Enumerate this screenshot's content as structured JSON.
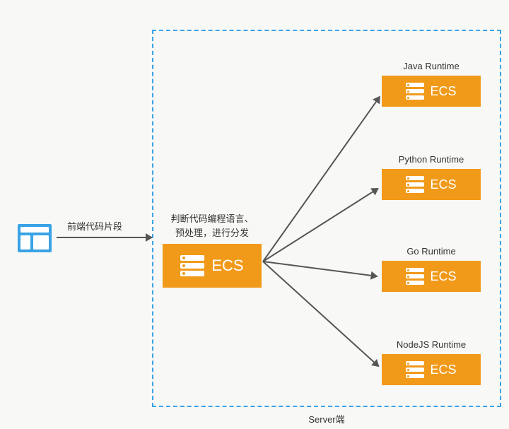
{
  "diagram": {
    "server_box_label": "Server端",
    "frontend": {
      "arrow_label": "前端代码片段"
    },
    "central": {
      "caption": "判断代码编程语言、\n预处理，进行分发",
      "label": "ECS"
    },
    "runtimes": [
      {
        "id": "java",
        "caption": "Java Runtime",
        "label": "ECS"
      },
      {
        "id": "python",
        "caption": "Python Runtime",
        "label": "ECS"
      },
      {
        "id": "go",
        "caption": "Go Runtime",
        "label": "ECS"
      },
      {
        "id": "node",
        "caption": "NodeJS Runtime",
        "label": "ECS"
      }
    ],
    "colors": {
      "box_orange": "#f19a1a",
      "dashed_blue": "#3aa3e6",
      "arrow": "#555555",
      "bg": "#f8f8f6"
    }
  }
}
